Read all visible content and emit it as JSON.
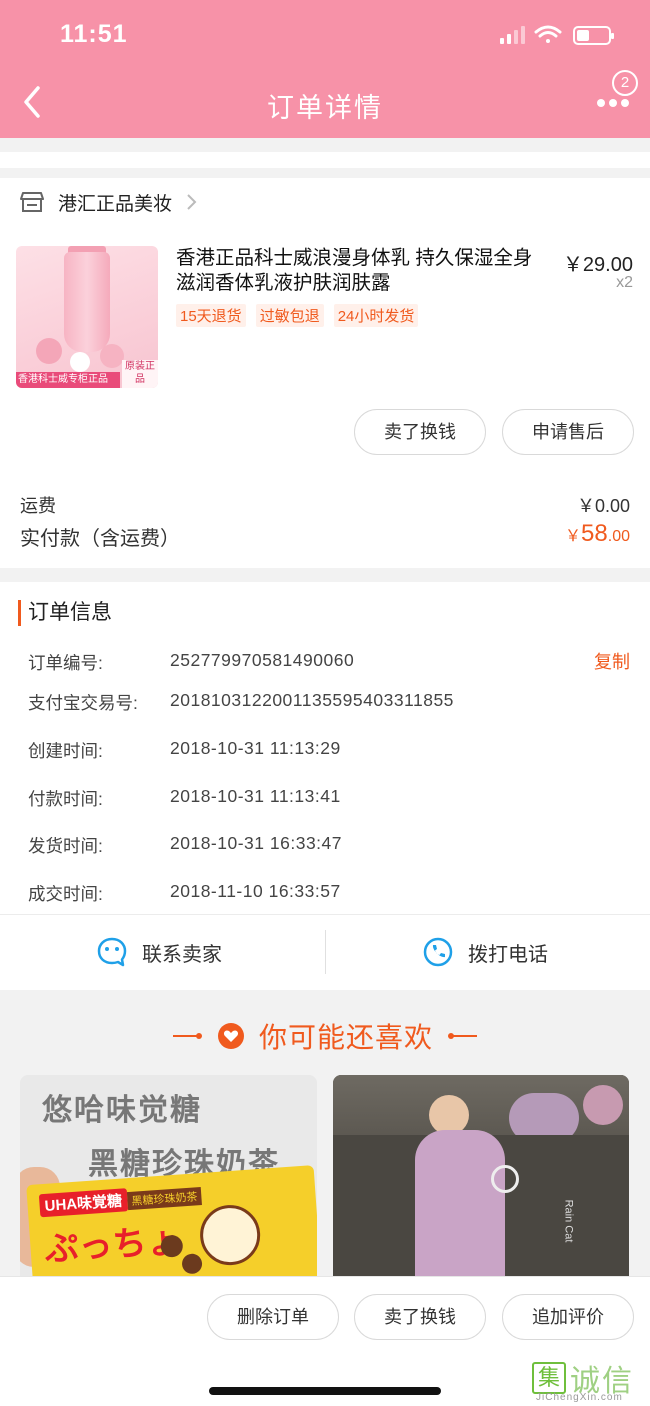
{
  "status": {
    "time": "11:51"
  },
  "nav": {
    "title": "订单详情",
    "badge_count": "2"
  },
  "shop": {
    "name": "港汇正品美妆"
  },
  "product": {
    "title": "香港正品科士威浪漫身体乳 持久保湿全身滋润香体乳液护肤润肤露",
    "price": "￥29.00",
    "qty": "x2",
    "tags": [
      "15天退货",
      "过敏包退",
      "24小时发货"
    ],
    "image_caption": "香港科士威专柜正品",
    "image_badge": "原装正品"
  },
  "item_actions": {
    "sell_label": "卖了换钱",
    "after_sale_label": "申请售后"
  },
  "fees": {
    "shipping_label": "运费",
    "shipping_value": "￥0.00",
    "total_label": "实付款（含运费）",
    "total_currency": "￥",
    "total_int": "58",
    "total_dec": ".00"
  },
  "order_info": {
    "heading": "订单信息",
    "copy_label": "复制",
    "rows": [
      {
        "label": "订单编号:",
        "value": "252779970581490060"
      },
      {
        "label": "支付宝交易号:",
        "value": "2018103122001135595403311855"
      },
      {
        "label": "创建时间:",
        "value": "2018-10-31 11:13:29"
      },
      {
        "label": "付款时间:",
        "value": "2018-10-31 11:13:41"
      },
      {
        "label": "发货时间:",
        "value": "2018-10-31 16:33:47"
      },
      {
        "label": "成交时间:",
        "value": "2018-11-10 16:33:57"
      }
    ]
  },
  "contact": {
    "seller_label": "联系卖家",
    "phone_label": "拨打电话"
  },
  "recommend": {
    "title": "你可能还喜欢",
    "item1_line1": "悠哈味觉糖",
    "item1_line2": "黑糖珍珠奶茶",
    "item1_brand": "UHA味覚糖",
    "item1_logo": "ぷっちょ",
    "item1_tag": "黑糖珍珠奶茶",
    "item2_caption": "Rain Cat"
  },
  "bottom_actions": {
    "delete_label": "删除订单",
    "sell_label": "卖了换钱",
    "review_label": "追加评价"
  },
  "watermark": {
    "char": "集",
    "text": "诚信",
    "sub": "JiChengXin.com"
  },
  "colors": {
    "header": "#f792a8",
    "accent": "#f05a1e",
    "tag_bg": "#fff0ea"
  }
}
